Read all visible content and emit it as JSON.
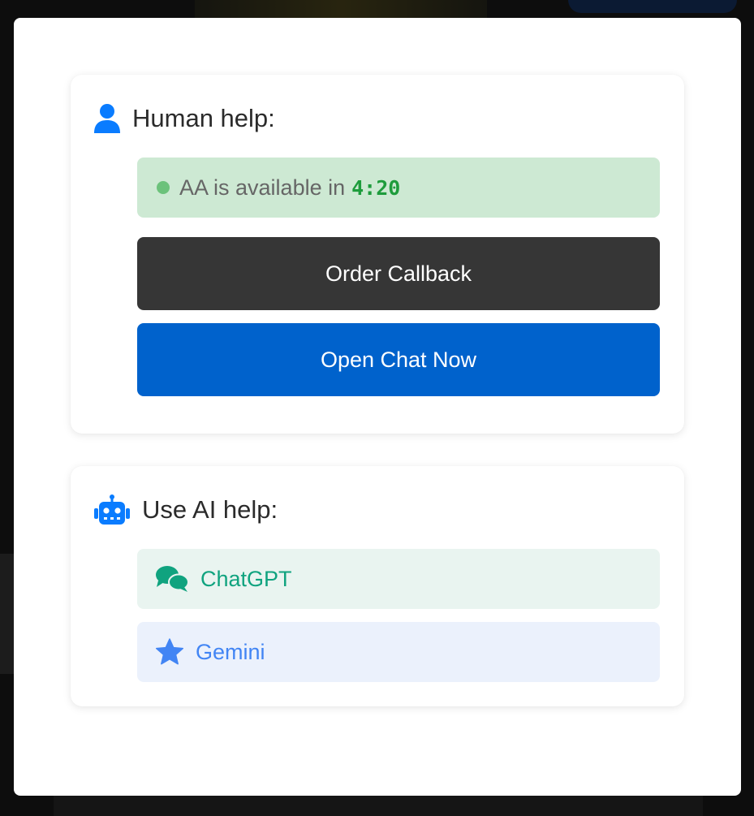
{
  "human_help": {
    "title": "Human help:",
    "icon": "user-icon",
    "status": {
      "text": "AA is available in",
      "time": "4:20",
      "dot_color": "#6cc27b"
    },
    "order_callback_label": "Order Callback",
    "open_chat_label": "Open Chat Now"
  },
  "ai_help": {
    "title": "Use AI help:",
    "icon": "robot-icon",
    "options": [
      {
        "label": "ChatGPT",
        "icon": "chat-bubbles-icon",
        "color": "#10a37f"
      },
      {
        "label": "Gemini",
        "icon": "star-icon",
        "color": "#4285f4"
      }
    ]
  },
  "colors": {
    "accent_blue": "#0a7cff",
    "callback_button": "#363636",
    "chat_button": "#0062cc",
    "status_background": "#cde9d3",
    "status_time": "#1e9c3c"
  }
}
